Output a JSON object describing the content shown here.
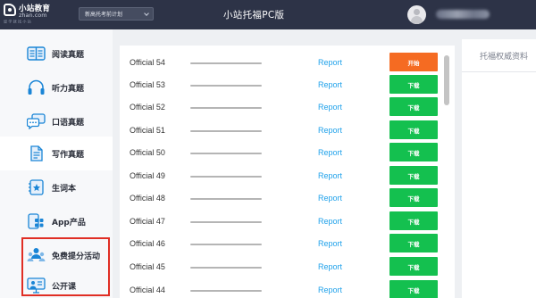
{
  "header": {
    "logo_name": "小站教育",
    "logo_domain": "zhan.com",
    "logo_slogan": "留 学 就 找 小 站",
    "plan_select": "新高托考前计划",
    "title": "小站托福PC版"
  },
  "sidebar": {
    "items": [
      {
        "label": "阅读真题",
        "icon": "book-icon"
      },
      {
        "label": "听力真题",
        "icon": "headphones-icon"
      },
      {
        "label": "口语真题",
        "icon": "speech-bubble-icon"
      },
      {
        "label": "写作真题",
        "icon": "document-icon"
      },
      {
        "label": "生词本",
        "icon": "vocabulary-icon"
      },
      {
        "label": "App产品",
        "icon": "app-grid-icon"
      },
      {
        "label": "免费提分活动",
        "icon": "people-icon"
      },
      {
        "label": "公开课",
        "icon": "presentation-icon"
      }
    ],
    "active_index": 3
  },
  "list": {
    "report_label": "Report",
    "download_label": "下载",
    "start_label": "开始",
    "rows": [
      {
        "name": "Official 54",
        "action": "start"
      },
      {
        "name": "Official 53",
        "action": "download"
      },
      {
        "name": "Official 52",
        "action": "download"
      },
      {
        "name": "Official 51",
        "action": "download"
      },
      {
        "name": "Official 50",
        "action": "download"
      },
      {
        "name": "Official 49",
        "action": "download"
      },
      {
        "name": "Official 48",
        "action": "download"
      },
      {
        "name": "Official 47",
        "action": "download"
      },
      {
        "name": "Official 46",
        "action": "download"
      },
      {
        "name": "Official 45",
        "action": "download"
      },
      {
        "name": "Official 44",
        "action": "download"
      }
    ]
  },
  "right_panel": {
    "title": "托福权威资料"
  },
  "colors": {
    "header_bg": "#2d3347",
    "accent_blue": "#1fa1ea",
    "download_green": "#14c04f",
    "start_orange": "#f56b22",
    "highlight_red": "#e02e24"
  }
}
